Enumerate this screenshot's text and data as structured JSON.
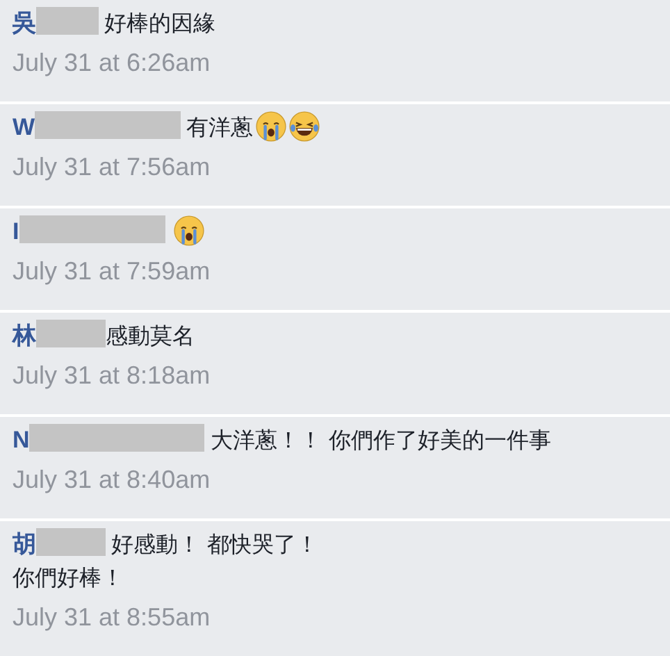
{
  "comments": [
    {
      "author": "吳",
      "text": "好棒的因緣",
      "time": "July 31 at 6:26am"
    },
    {
      "author": "W",
      "text": "有洋蔥",
      "emojis": [
        {
          "kind": "crying"
        },
        {
          "kind": "laughing"
        }
      ],
      "time": "July 31 at 7:56am"
    },
    {
      "author": "I",
      "emojis": [
        {
          "kind": "crying"
        }
      ],
      "time": "July 31 at 7:59am"
    },
    {
      "author": "林",
      "text": "感動莫名",
      "time": "July 31 at 8:18am"
    },
    {
      "author": "N",
      "text": "大洋蔥！！ 你們作了好美的一件事",
      "time": "July 31 at 8:40am"
    },
    {
      "author": "胡",
      "text": "好感動！ 都快哭了！",
      "next_line": "你們好棒！",
      "time": "July 31 at 8:55am"
    }
  ]
}
